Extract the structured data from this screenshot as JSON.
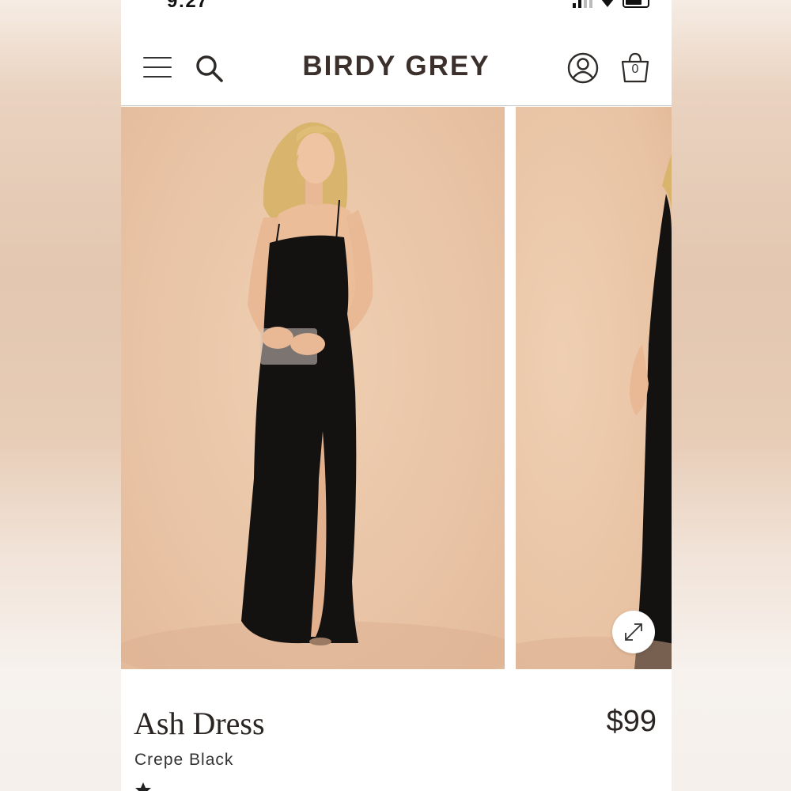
{
  "status_bar": {
    "time": "9:27"
  },
  "header": {
    "brand": "BIRDY GREY",
    "cart_count": "0"
  },
  "product": {
    "name": "Ash Dress",
    "color": "Crepe Black",
    "price": "$99"
  },
  "icons": {
    "menu": "hamburger-menu-icon",
    "search": "search-icon",
    "account": "user-account-icon",
    "cart": "shopping-bag-icon",
    "expand": "expand-arrows-icon",
    "rating": "star-icon"
  },
  "colors": {
    "brand_text": "#3b302b",
    "photo_background": "#e9c4a6",
    "dress": "#141111"
  }
}
